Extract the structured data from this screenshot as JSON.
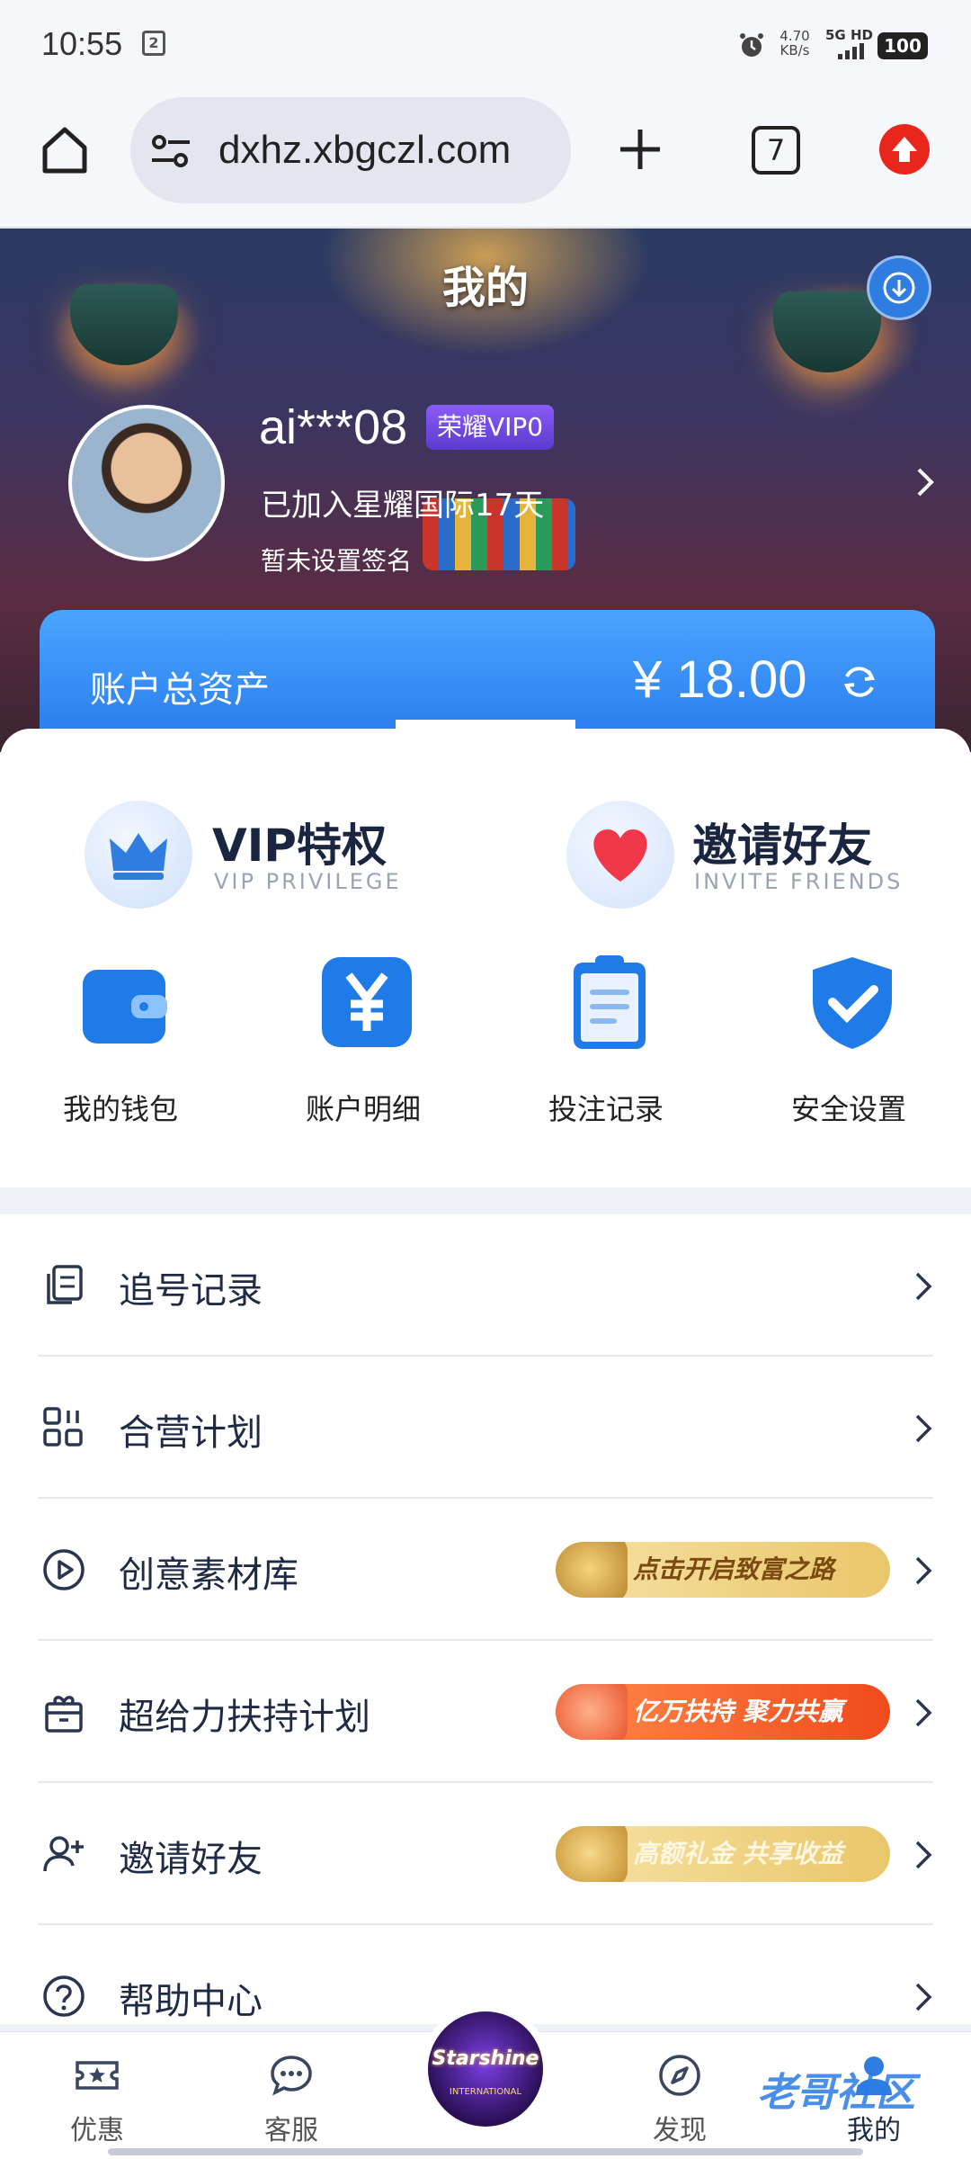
{
  "status_bar": {
    "time": "10:55",
    "speed_value": "4.70",
    "speed_unit": "KB/s",
    "network": "5G HD",
    "battery": "100",
    "sim_icon": "sim-icon",
    "alarm_icon": "alarm-icon"
  },
  "browser": {
    "url": "dxhz.xbgczl.com",
    "tab_count": "7",
    "icons": [
      "home-icon",
      "site-settings-icon",
      "new-tab-icon",
      "tabs-icon",
      "update-icon"
    ]
  },
  "profile": {
    "page_title": "我的",
    "username": "ai***08",
    "vip_badge": "荣耀VIP0",
    "joined_text": "已加入星耀国际17天",
    "signature": "暂未设置签名"
  },
  "assets": {
    "label": "账户总资产",
    "value": "¥ 18.00"
  },
  "features": {
    "vip_title": "VIP特权",
    "vip_sub": "VIP PRIVILEGE",
    "invite_title": "邀请好友",
    "invite_sub": "INVITE FRIENDS"
  },
  "quick_actions": [
    {
      "label": "我的钱包",
      "icon": "wallet-icon"
    },
    {
      "label": "账户明细",
      "icon": "yen-icon"
    },
    {
      "label": "投注记录",
      "icon": "clipboard-icon"
    },
    {
      "label": "安全设置",
      "icon": "shield-check-icon"
    }
  ],
  "menu": [
    {
      "label": "追号记录",
      "icon": "copy-list-icon",
      "promo": ""
    },
    {
      "label": "合营计划",
      "icon": "grid-apps-icon",
      "promo": ""
    },
    {
      "label": "创意素材库",
      "icon": "play-circle-icon",
      "promo": "点击开启致富之路"
    },
    {
      "label": "超给力扶持计划",
      "icon": "gift-icon",
      "promo": "亿万扶持 聚力共赢"
    },
    {
      "label": "邀请好友",
      "icon": "add-user-icon",
      "promo": "高额礼金 共享收益"
    },
    {
      "label": "帮助中心",
      "icon": "help-icon",
      "promo": ""
    }
  ],
  "colors": {
    "accent_blue": "#1f6fe8",
    "promo_gold": "#f3d27a",
    "promo_orange": "#f0622a"
  },
  "bottom_nav": [
    {
      "label": "优惠",
      "icon": "ticket-star-icon"
    },
    {
      "label": "客服",
      "icon": "chat-bubble-icon"
    },
    {
      "label": "",
      "icon": "starshine-logo"
    },
    {
      "label": "发现",
      "icon": "compass-icon"
    },
    {
      "label": "我的",
      "icon": "person-icon"
    }
  ],
  "logo": {
    "text": "Starshine",
    "sub": "INTERNATIONAL"
  },
  "watermark": "老哥社区"
}
